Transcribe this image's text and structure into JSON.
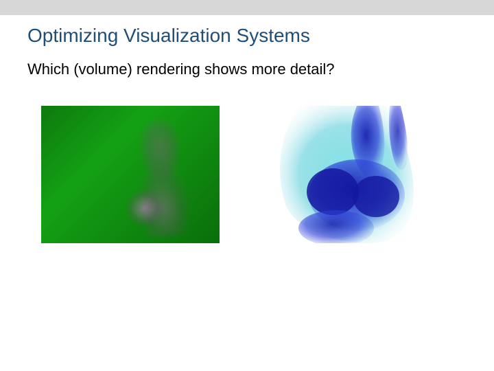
{
  "slide": {
    "title": "Optimizing Visualization Systems",
    "question": "Which (volume) rendering shows more detail?"
  },
  "renderings": {
    "left": {
      "alt": "green-magenta volume rendering of ankle joint"
    },
    "right": {
      "alt": "blue-cyan volume rendering of ankle joint"
    }
  }
}
